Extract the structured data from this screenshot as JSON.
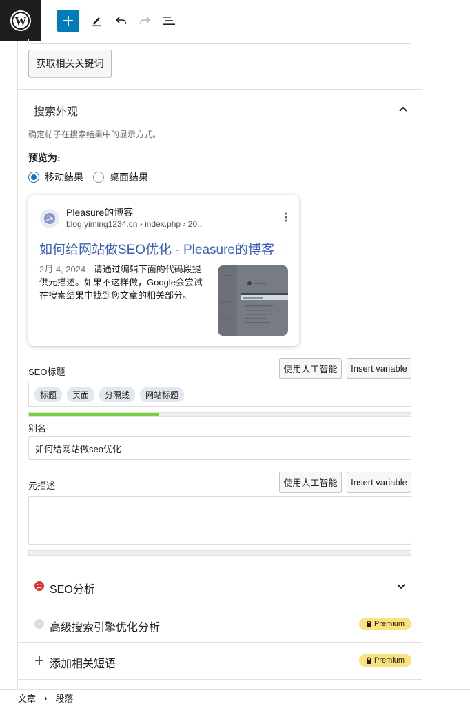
{
  "toolbar": {
    "logo_icon": "wordpress-icon",
    "add_label": "+",
    "tools": [
      "pencil-icon",
      "undo-icon",
      "redo-icon",
      "list-view-icon"
    ]
  },
  "keyword_button": "获取相关关键词",
  "search_appearance": {
    "title": "搜索外观",
    "description": "确定帖子在搜索结果中的显示方式。",
    "preview_label": "预览为:",
    "options": [
      {
        "label": "移动结果",
        "selected": true
      },
      {
        "label": "桌面结果",
        "selected": false
      }
    ]
  },
  "preview": {
    "site_name": "Pleasure的博客",
    "url": "blog.yiming1234.cn › index.php › 20...",
    "title": "如何给网站做SEO优化 - Pleasure的博客",
    "date": "2月 4, 2024",
    "date_sep": " - ",
    "snippet": "请通过编辑下面的代码段提供元描述。如果不这样做，Google会尝试在搜索结果中找到您文章的相关部分。"
  },
  "seo_title": {
    "label": "SEO标题",
    "ai_button": "使用人工智能",
    "variable_button": "Insert variable",
    "chips": [
      "标题",
      "页面",
      "分隔线",
      "网站标题"
    ],
    "progress": 0.34
  },
  "slug": {
    "label": "别名",
    "value": "如何给网站做seo优化"
  },
  "meta_desc": {
    "label": "元描述",
    "ai_button": "使用人工智能",
    "variable_button": "Insert variable",
    "value": ""
  },
  "sections": {
    "seo_analysis": "SEO分析",
    "advanced": "高级搜索引擎优化分析",
    "related": "添加相关短语",
    "premium_label": "Premium"
  },
  "colors": {
    "accent": "#007cba",
    "progress": "#7ad03a",
    "link": "#3c5ec5",
    "premium": "#fbe27c",
    "error": "#dc3232"
  },
  "breadcrumb": [
    "文章",
    "段落"
  ]
}
